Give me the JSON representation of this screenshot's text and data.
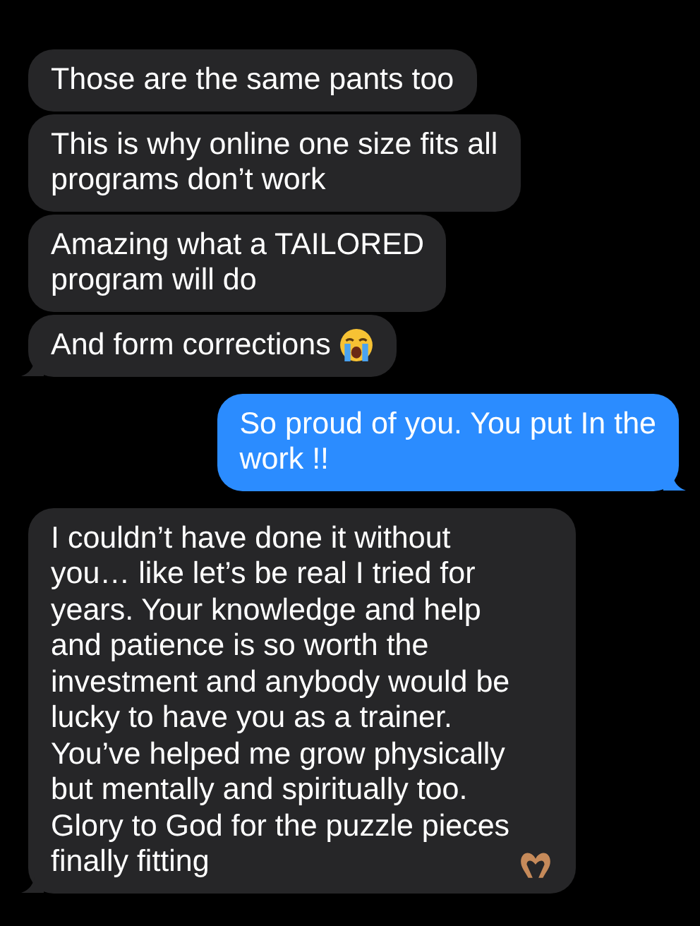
{
  "messages": [
    {
      "kind": "received",
      "text": "Those are the same pants too",
      "tail": false
    },
    {
      "kind": "received",
      "text": "This is why online one size fits all\nprograms don’t work",
      "tail": false
    },
    {
      "kind": "received",
      "text": "Amazing what a TAILORED\nprogram will do",
      "tail": false
    },
    {
      "kind": "received",
      "text": "And form corrections",
      "emoji": {
        "kind": "crying"
      },
      "tail": true
    },
    {
      "kind": "sent",
      "text": "So proud of you. You put In the\nwork !!",
      "tail": true
    },
    {
      "kind": "received",
      "text": "I couldn’t have done it without\nyou… like let’s be real I tried for\nyears. Your knowledge and help\nand patience is so worth the\ninvestment and anybody would be\nlucky to have you as a trainer.\nYou’ve helped me grow physically\nbut mentally and spiritually too.\nGlory to God for the puzzle pieces\nfinally fitting",
      "emoji": {
        "kind": "heart-hands"
      },
      "tail": true
    }
  ]
}
